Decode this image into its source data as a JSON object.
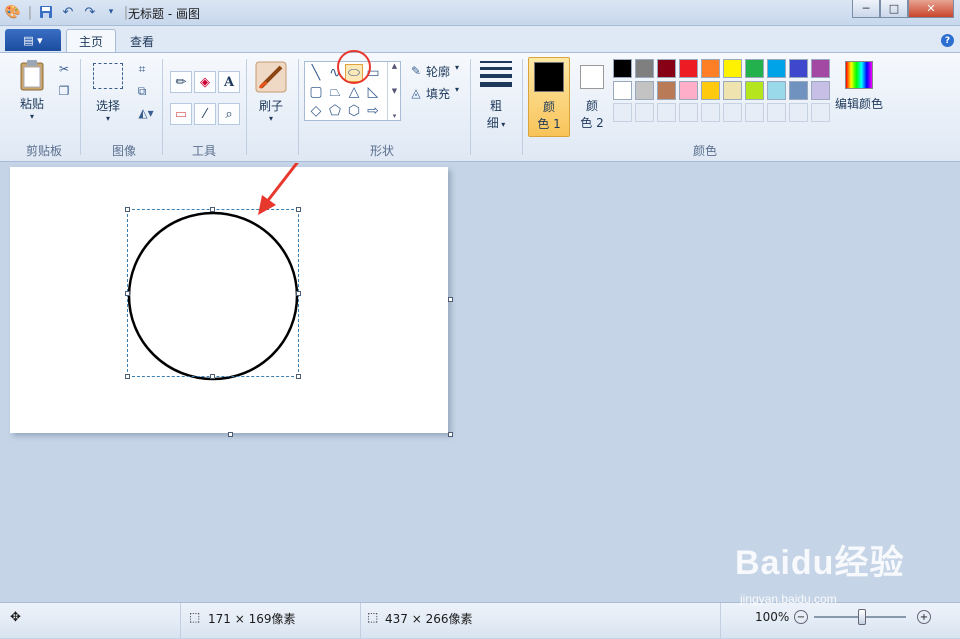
{
  "window": {
    "title": "无标题 - 画图",
    "minimize_symbol": "─",
    "maximize_symbol": "□",
    "close_symbol": "✕"
  },
  "quick_access": {
    "icons": [
      "paint-app-icon",
      "save-icon",
      "undo-icon",
      "redo-icon",
      "customize-dropdown-icon"
    ]
  },
  "tabs": {
    "menu_symbol": "▤ ▾",
    "home": "主页",
    "view": "查看",
    "help_symbol": "?"
  },
  "ribbon": {
    "clipboard": {
      "paste_label": "粘贴",
      "group_label": "剪贴板"
    },
    "image": {
      "select_label": "选择",
      "group_label": "图像"
    },
    "tools": {
      "group_label": "工具",
      "text_tool_glyph": "A"
    },
    "brushes": {
      "label": "刷子"
    },
    "shapes": {
      "outline_label": "轮廓",
      "fill_label": "填充",
      "group_label": "形状"
    },
    "size": {
      "label_line1": "粗",
      "label_line2": "细"
    },
    "colors": {
      "color1_line1": "颜",
      "color1_line2": "色 1",
      "color2_line1": "颜",
      "color2_line2": "色 2",
      "edit_label": "编辑颜色",
      "group_label": "颜色",
      "color1_value": "#000000",
      "color2_value": "#ffffff",
      "palette_row1": [
        "#000000",
        "#7f7f7f",
        "#880015",
        "#ed1c24",
        "#ff7f27",
        "#fff200",
        "#22b14c",
        "#00a2e8",
        "#3f48cc",
        "#a349a4"
      ],
      "palette_row2": [
        "#ffffff",
        "#c3c3c3",
        "#b97a57",
        "#ffaec9",
        "#ffc90e",
        "#efe4b0",
        "#b5e61d",
        "#99d9ea",
        "#7092be",
        "#c8bfe7"
      ]
    }
  },
  "status": {
    "selection_size": "171 × 169像素",
    "canvas_size": "437 × 266像素",
    "zoom": "100%"
  },
  "watermark": {
    "text": "Baidu经验",
    "url": "jingyan.baidu.com"
  }
}
